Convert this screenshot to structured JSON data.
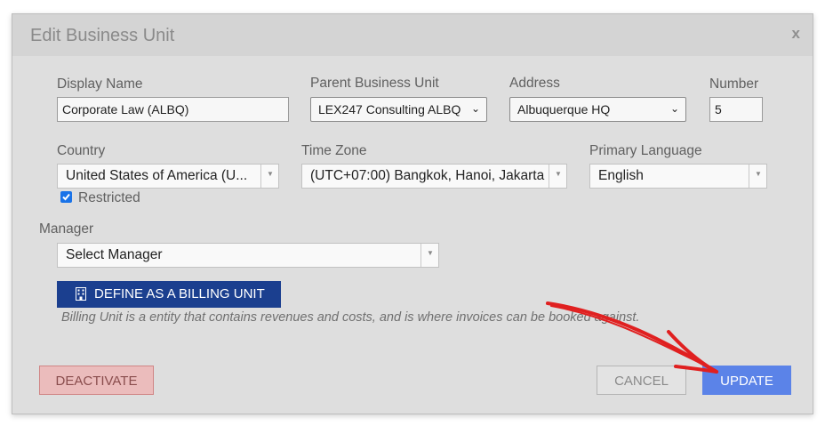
{
  "dialog": {
    "title": "Edit Business Unit",
    "close_label": "x"
  },
  "fields": {
    "display_name": {
      "label": "Display Name",
      "value": "Corporate Law (ALBQ)"
    },
    "parent_business_unit": {
      "label": "Parent Business Unit",
      "value": "LEX247 Consulting ALBQ"
    },
    "address": {
      "label": "Address",
      "value": "Albuquerque HQ"
    },
    "number": {
      "label": "Number",
      "value": "5"
    },
    "country": {
      "label": "Country",
      "value": "United States of America (U..."
    },
    "restricted": {
      "label": "Restricted",
      "checked": true
    },
    "time_zone": {
      "label": "Time Zone",
      "value": "(UTC+07:00) Bangkok, Hanoi, Jakarta"
    },
    "primary_language": {
      "label": "Primary Language",
      "value": "English"
    },
    "manager": {
      "label": "Manager",
      "value": "Select Manager"
    }
  },
  "billing": {
    "button_label": "DEFINE AS A BILLING UNIT",
    "note": "Billing Unit is a entity that contains revenues and costs, and is where invoices can be booked against."
  },
  "footer": {
    "deactivate_label": "DEACTIVATE",
    "cancel_label": "CANCEL",
    "update_label": "UPDATE"
  },
  "colors": {
    "primary": "#5b83e8",
    "billing_button": "#1b3f8f",
    "deactivate_bg": "#ebbcbc",
    "annotation_arrow": "#e02020"
  },
  "icons": [
    "close-icon",
    "chevron-down-icon",
    "caret-down-icon",
    "checkbox-checked-icon",
    "building-icon",
    "annotation-arrow"
  ]
}
